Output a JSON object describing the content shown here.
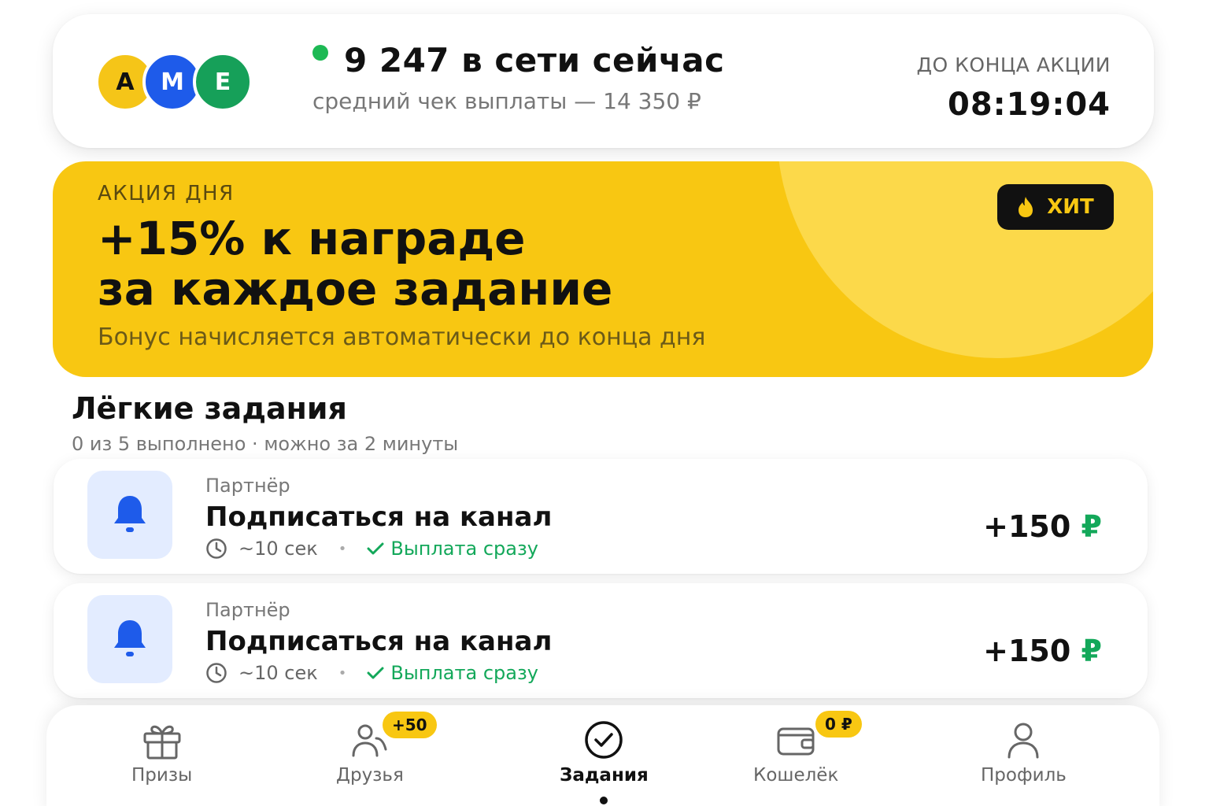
{
  "header": {
    "avatars": [
      {
        "letter": "А",
        "color": "#F5C518"
      },
      {
        "letter": "М",
        "color": "#1E5BEA"
      },
      {
        "letter": "Е",
        "color": "#16A059"
      }
    ],
    "online_text": "9 247 в сети сейчас",
    "avg_check": "средний чек выплаты — 14 350 ₽",
    "timer_label": "ДО КОНЦА АКЦИИ",
    "timer_value": "08:19:04"
  },
  "promo": {
    "kicker": "АКЦИЯ ДНЯ",
    "title_line1": "+15% к награде",
    "title_line2": "за каждое задание",
    "subtitle": "Бонус начисляется автоматически до конца дня",
    "badge_label": "ХИТ",
    "badge_icon": "fire-icon",
    "color": "#F8C712"
  },
  "section": {
    "title": "Лёгкие задания",
    "subtitle": "0 из 5 выполнено · можно за 2 минуты"
  },
  "tasks": [
    {
      "icon": "bell-icon",
      "kicker": "Партнёр",
      "title": "Подписаться на канал",
      "duration": "~10 сек",
      "separator": "•",
      "payout": "Выплата сразу",
      "reward_value": "+150",
      "reward_currency": "₽"
    },
    {
      "icon": "bell-icon",
      "kicker": "Партнёр",
      "title": "Подписаться на канал",
      "duration": "~10 сек",
      "separator": "•",
      "payout": "Выплата сразу",
      "reward_value": "+150",
      "reward_currency": "₽"
    }
  ],
  "nav": {
    "items": [
      {
        "label": "Призы",
        "icon": "gift-icon"
      },
      {
        "label": "Друзья",
        "icon": "users-icon",
        "badge": "+50"
      },
      {
        "label": "Задания",
        "icon": "check-circle-icon",
        "active": true
      },
      {
        "label": "Кошелёк",
        "icon": "wallet-icon",
        "badge": "0 ₽"
      },
      {
        "label": "Профиль",
        "icon": "user-icon"
      }
    ]
  },
  "colors": {
    "accent_yellow": "#F8C712",
    "online_green": "#1DB954",
    "payout_green": "#13A85A",
    "bell_blue": "#1E5BEA"
  }
}
